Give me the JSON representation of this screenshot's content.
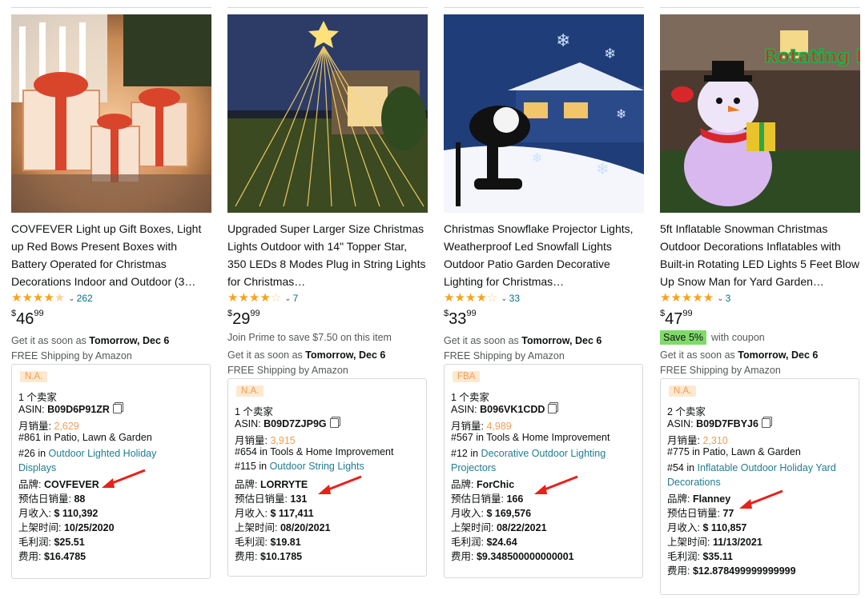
{
  "products": [
    {
      "title": "COVFEVER Light up Gift Boxes, Light up Red Bows Present Boxes with Battery Operated for Christmas Decorations Indoor and Outdoor (3…",
      "rating_count": "262",
      "stars": 4.5,
      "price_whole": "46",
      "price_cents": "99",
      "price_symbol": "$",
      "prime_note": "",
      "coupon": "",
      "coupon_text": "",
      "delivery_prefix": "Get it as soon as",
      "delivery_date": "Tomorrow, Dec 6",
      "shipping": "FREE Shipping by Amazon",
      "box": {
        "tag": "N.A.",
        "sellers": "1 个卖家",
        "asin_label": "ASIN:",
        "asin": "B09D6P91ZR",
        "monthly_sales_label": "月销量:",
        "monthly_sales": "2,629",
        "rank1": "#861 in Patio, Lawn & Garden",
        "rank2_prefix": "#26 in",
        "rank2_category": "Outdoor Lighted Holiday Displays",
        "brand_label": "品牌:",
        "brand": "COVFEVER",
        "daily_sales_label": "预估日销量:",
        "daily_sales": "88",
        "monthly_revenue_label": "月收入:",
        "monthly_revenue": "$ 110,392",
        "listed_label": "上架时间:",
        "listed": "10/25/2020",
        "profit_label": "毛利润:",
        "profit": "$25.51",
        "fee_label": "费用:",
        "fee": "$16.4785"
      }
    },
    {
      "title": "Upgraded Super Larger Size Christmas Lights Outdoor with 14\" Topper Star, 350 LEDs 8 Modes Plug in String Lights for Christmas…",
      "rating_count": "7",
      "stars": 4.0,
      "price_whole": "29",
      "price_cents": "99",
      "price_symbol": "$",
      "prime_note": "Join Prime to save $7.50 on this item",
      "coupon": "",
      "coupon_text": "",
      "delivery_prefix": "Get it as soon as",
      "delivery_date": "Tomorrow, Dec 6",
      "shipping": "FREE Shipping by Amazon",
      "box": {
        "tag": "N.A.",
        "sellers": "1 个卖家",
        "asin_label": "ASIN:",
        "asin": "B09D7ZJP9G",
        "monthly_sales_label": "月销量:",
        "monthly_sales": "3,915",
        "rank1": "#654 in Tools & Home Improvement",
        "rank2_prefix": "#115 in",
        "rank2_category": "Outdoor String Lights",
        "brand_label": "品牌:",
        "brand": "LORRYTE",
        "daily_sales_label": "预估日销量:",
        "daily_sales": "131",
        "monthly_revenue_label": "月收入:",
        "monthly_revenue": "$ 117,411",
        "listed_label": "上架时间:",
        "listed": "08/20/2021",
        "profit_label": "毛利润:",
        "profit": "$19.81",
        "fee_label": "费用:",
        "fee": "$10.1785"
      }
    },
    {
      "title": "Christmas Snowflake Projector Lights, Weatherproof Led Snowfall Lights Outdoor Patio Garden Decorative Lighting for Christmas…",
      "rating_count": "33",
      "stars": 4.0,
      "price_whole": "33",
      "price_cents": "99",
      "price_symbol": "$",
      "prime_note": "",
      "coupon": "",
      "coupon_text": "",
      "delivery_prefix": "Get it as soon as",
      "delivery_date": "Tomorrow, Dec 6",
      "shipping": "FREE Shipping by Amazon",
      "box": {
        "tag": "FBA",
        "sellers": "1 个卖家",
        "asin_label": "ASIN:",
        "asin": "B096VK1CDD",
        "monthly_sales_label": "月销量:",
        "monthly_sales": "4,989",
        "rank1": "#567 in Tools & Home Improvement",
        "rank2_prefix": "#12 in",
        "rank2_category": "Decorative Outdoor Lighting Projectors",
        "brand_label": "品牌:",
        "brand": "ForChic",
        "daily_sales_label": "预估日销量:",
        "daily_sales": "166",
        "monthly_revenue_label": "月收入:",
        "monthly_revenue": "$ 169,576",
        "listed_label": "上架时间:",
        "listed": "08/22/2021",
        "profit_label": "毛利润:",
        "profit": "$24.64",
        "fee_label": "费用:",
        "fee": "$9.348500000000001"
      }
    },
    {
      "title": "5ft Inflatable Snowman Christmas Outdoor Decorations Inflatables with Built-in Rotating LED Lights 5 Feet Blow Up Snow Man for Yard Garden…",
      "rating_count": "3",
      "stars": 5.0,
      "price_whole": "47",
      "price_cents": "99",
      "price_symbol": "$",
      "prime_note": "",
      "coupon": "Save 5%",
      "coupon_text": "with coupon",
      "delivery_prefix": "Get it as soon as",
      "delivery_date": "Tomorrow, Dec 6",
      "shipping": "FREE Shipping by Amazon",
      "image_text": "Rotating Light",
      "box": {
        "tag": "N.A.",
        "sellers": "2 个卖家",
        "asin_label": "ASIN:",
        "asin": "B09D7FBYJ6",
        "monthly_sales_label": "月销量:",
        "monthly_sales": "2,310",
        "rank1": "#775 in Patio, Lawn & Garden",
        "rank2_prefix": "#54 in",
        "rank2_category": "Inflatable Outdoor Holiday Yard Decorations",
        "brand_label": "品牌:",
        "brand": "Flanney",
        "daily_sales_label": "预估日销量:",
        "daily_sales": "77",
        "monthly_revenue_label": "月收入:",
        "monthly_revenue": "$ 110,857",
        "listed_label": "上架时间:",
        "listed": "11/13/2021",
        "profit_label": "毛利润:",
        "profit": "$35.11",
        "fee_label": "费用:",
        "fee": "$12.878499999999999"
      }
    }
  ],
  "colors": {
    "star": "#f7a21b",
    "link": "#007185",
    "orange_value": "#f39c52",
    "coupon_badge": "#7fda69",
    "arrow": "#e8201a"
  },
  "icons": {
    "copy": "copy-icon",
    "chevron": "chevron-down-icon",
    "arrow": "red-arrow-annotation"
  }
}
